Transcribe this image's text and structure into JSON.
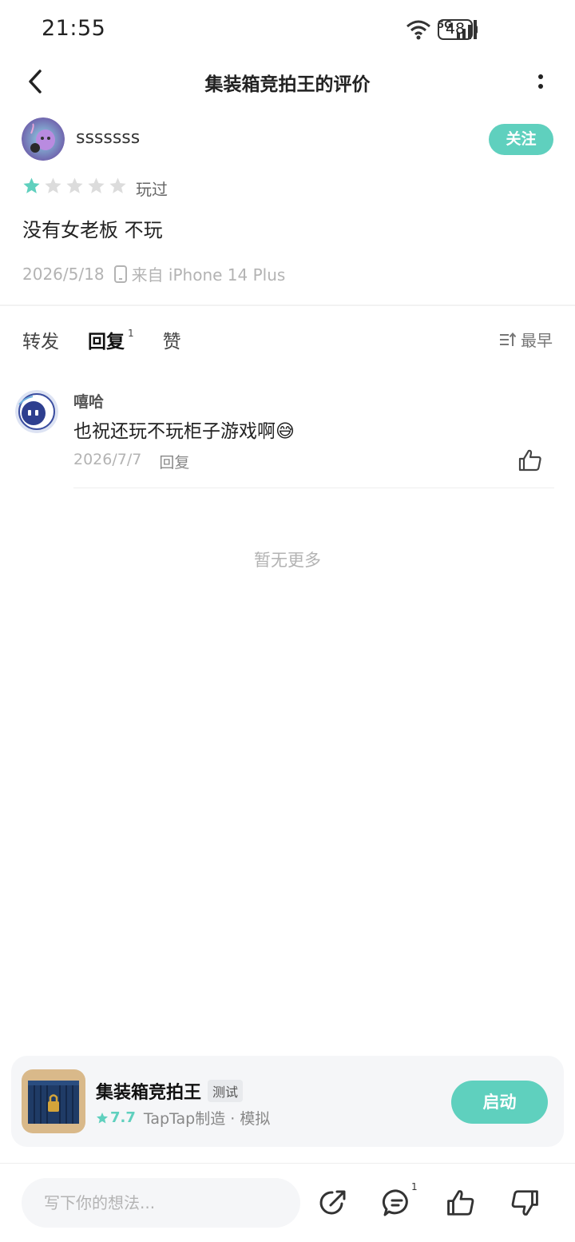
{
  "status_bar": {
    "time": "21:55",
    "signal_label": "5G",
    "battery": "48"
  },
  "header": {
    "title": "集装箱竞拍王的评价"
  },
  "review": {
    "author_name": "sssssss",
    "follow_label": "关注",
    "rating": 1,
    "rating_max": 5,
    "played_label": "玩过",
    "text": "没有女老板 不玩",
    "date": "2026/5/18",
    "device": "来自 iPhone 14 Plus"
  },
  "tabs": {
    "items": [
      {
        "label": "转发"
      },
      {
        "label": "回复",
        "count": "1",
        "active": true
      },
      {
        "label": "赞"
      }
    ],
    "sort_label": "最早"
  },
  "replies": [
    {
      "name": "嘻哈",
      "text": "也祝还玩不玩柜子游戏啊😅",
      "date": "2026/7/7",
      "reply_label": "回复"
    }
  ],
  "no_more_label": "暂无更多",
  "game_card": {
    "title": "集装箱竞拍王",
    "tag": "测试",
    "score": "7.7",
    "subtitle": "TapTap制造 · 模拟",
    "launch_label": "启动"
  },
  "bottom_bar": {
    "input_placeholder": "写下你的想法...",
    "comment_count": "1"
  },
  "colors": {
    "accent": "#5fd0be",
    "star_empty": "#d9d9d9",
    "muted_text": "#b3b3b3"
  }
}
